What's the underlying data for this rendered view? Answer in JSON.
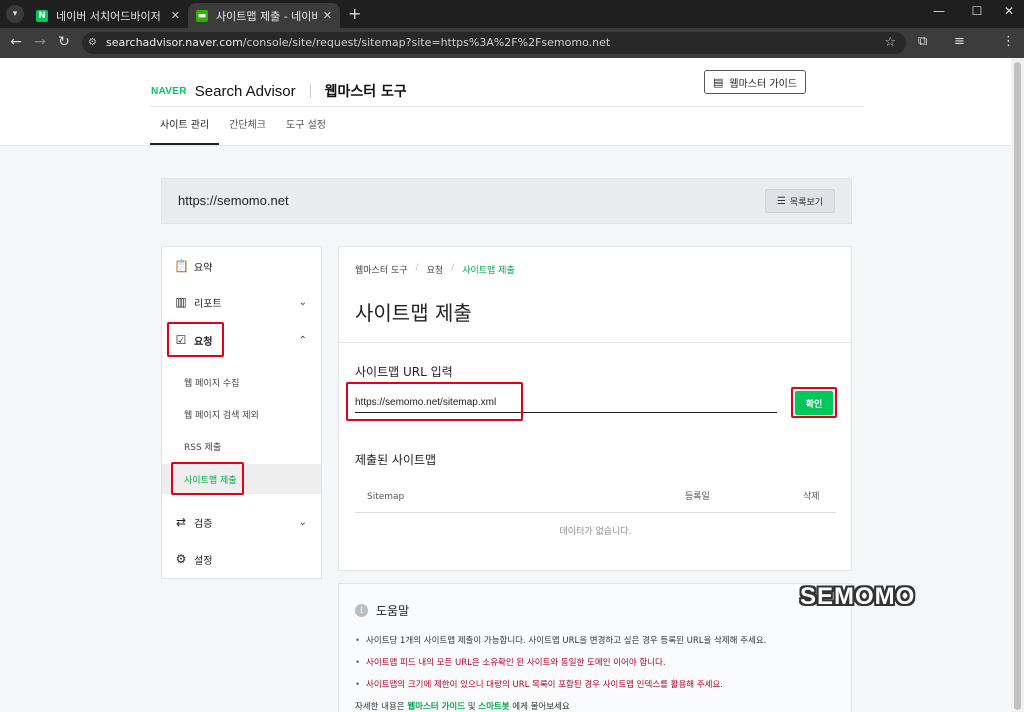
{
  "browser": {
    "tabs": [
      {
        "title": "네이버 서치어드바이저 : 네이버",
        "active": false
      },
      {
        "title": "사이트맵 제출 - 네이버 서치어",
        "active": true
      }
    ],
    "url_host": "searchadvisor.naver.com",
    "url_path": "/console/site/request/sitemap?site=https%3A%2F%2Fsemomo.net"
  },
  "header": {
    "logo_naver": "NAVER",
    "logo_product": "Search Advisor",
    "logo_tool": "웹마스터 도구",
    "guide_button": "웹마스터 가이드",
    "gnb": [
      "사이트 관리",
      "간단체크",
      "도구 설정"
    ]
  },
  "site": {
    "url": "https://semomo.net",
    "list_button": "목록보기"
  },
  "sidebar": {
    "items": [
      {
        "label": "요약",
        "icon": "clipboard-icon"
      },
      {
        "label": "리포트",
        "icon": "chart-icon"
      },
      {
        "label": "요청",
        "icon": "checkbox-icon"
      },
      {
        "label": "검증",
        "icon": "repeat-icon"
      },
      {
        "label": "설정",
        "icon": "gear-icon"
      }
    ],
    "sub_items": [
      "웹 페이지 수집",
      "웹 페이지 검색 제외",
      "RSS 제출",
      "사이트맵 제출"
    ]
  },
  "main": {
    "breadcrumb": [
      "웹마스터 도구",
      "요청",
      "사이트맵 제출"
    ],
    "title": "사이트맵 제출",
    "input_label": "사이트맵 URL 입력",
    "input_value": "https://semomo.net/sitemap.xml",
    "confirm_button": "확인",
    "submitted_label": "제출된 사이트맵",
    "table_headers": [
      "Sitemap",
      "등록일",
      "삭제"
    ],
    "table_empty": "데이터가 없습니다."
  },
  "help": {
    "title": "도움말",
    "items": [
      "사이트당 1개의 사이트맵 제출이 가능합니다. 사이트맵 URL을 변경하고 싶은 경우 등록된 URL을 삭제해 주세요.",
      "사이트맵 피드 내의 모든 URL은 소유확인 된 사이트와 동일한 도메인 이어야 합니다.",
      "사이트맵의 크기에 제한이 있으니 대량의 URL 목록이 포함된 경우 사이트맵 인덱스를 활용해 주세요."
    ],
    "more_prefix": "자세한 내용은",
    "more_link1": "웹마스터 가이드",
    "more_and": "및",
    "more_link2": "스마트봇",
    "more_suffix": "에게 물어보세요"
  },
  "watermark": "SEMOMO",
  "colors": {
    "accent": "#03c75a",
    "highlight": "#e3001b"
  }
}
